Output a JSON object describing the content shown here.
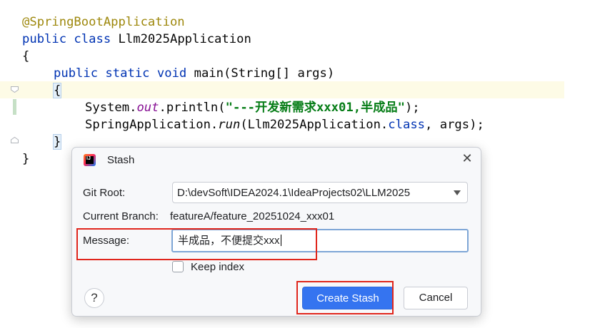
{
  "editor": {
    "line1": "@SpringBootApplication",
    "line2_kw": "public class",
    "line2_name": " Llm2025Application",
    "line3": "{",
    "line4_kw": "public static void",
    "line4_rest": " main(String[] args)",
    "line5": "{",
    "line6_a": "System.",
    "line6_field": "out",
    "line6_b": ".println(",
    "line6_str": "\"---开发新需求xxx01,半成品\"",
    "line6_c": ");",
    "line7_a": "SpringApplication.",
    "line7_run": "run",
    "line7_b": "(Llm2025Application.",
    "line7_kw": "class",
    "line7_c": ", args);",
    "line8": "}",
    "line9": "}"
  },
  "dialog": {
    "title": "Stash",
    "git_root_label": "Git Root:",
    "git_root_value": "D:\\devSoft\\IDEA2024.1\\IdeaProjects02\\LLM2025",
    "branch_label": "Current Branch:",
    "branch_value": "featureA/feature_20251024_xxx01",
    "message_label": "Message:",
    "message_value": "半成品，不便提交xxx",
    "keep_index_label": "Keep index",
    "keep_index_checked": false,
    "help_glyph": "?",
    "create_label": "Create Stash",
    "cancel_label": "Cancel",
    "close_glyph": "✕"
  },
  "colors": {
    "primary_button": "#3574f0",
    "annotation_red": "#e0261c",
    "keyword": "#0033b3",
    "string": "#067d17",
    "annotation": "#9e880d"
  }
}
